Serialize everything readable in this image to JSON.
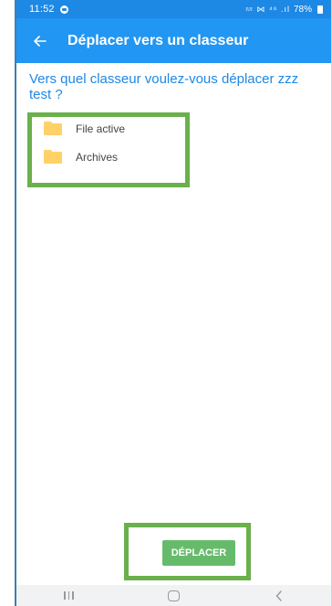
{
  "status_bar": {
    "time": "11:52",
    "indicators": "𝌂 ⋈ ⁴⁶ .ıl",
    "battery": "78%"
  },
  "app_bar": {
    "back_icon": "arrow-left-icon",
    "title": "Déplacer vers un classeur"
  },
  "prompt": "Vers quel classeur voulez-vous déplacer zzz test ?",
  "folders": [
    {
      "label": "File active",
      "icon": "folder-icon"
    },
    {
      "label": "Archives",
      "icon": "folder-icon"
    }
  ],
  "move_button": {
    "label": "DÉPLACER"
  },
  "colors": {
    "primary": "#2196f3",
    "status_bar": "#1e88e5",
    "folder": "#ffd166",
    "button": "#66bb6a",
    "highlight": "#6ab04c"
  }
}
